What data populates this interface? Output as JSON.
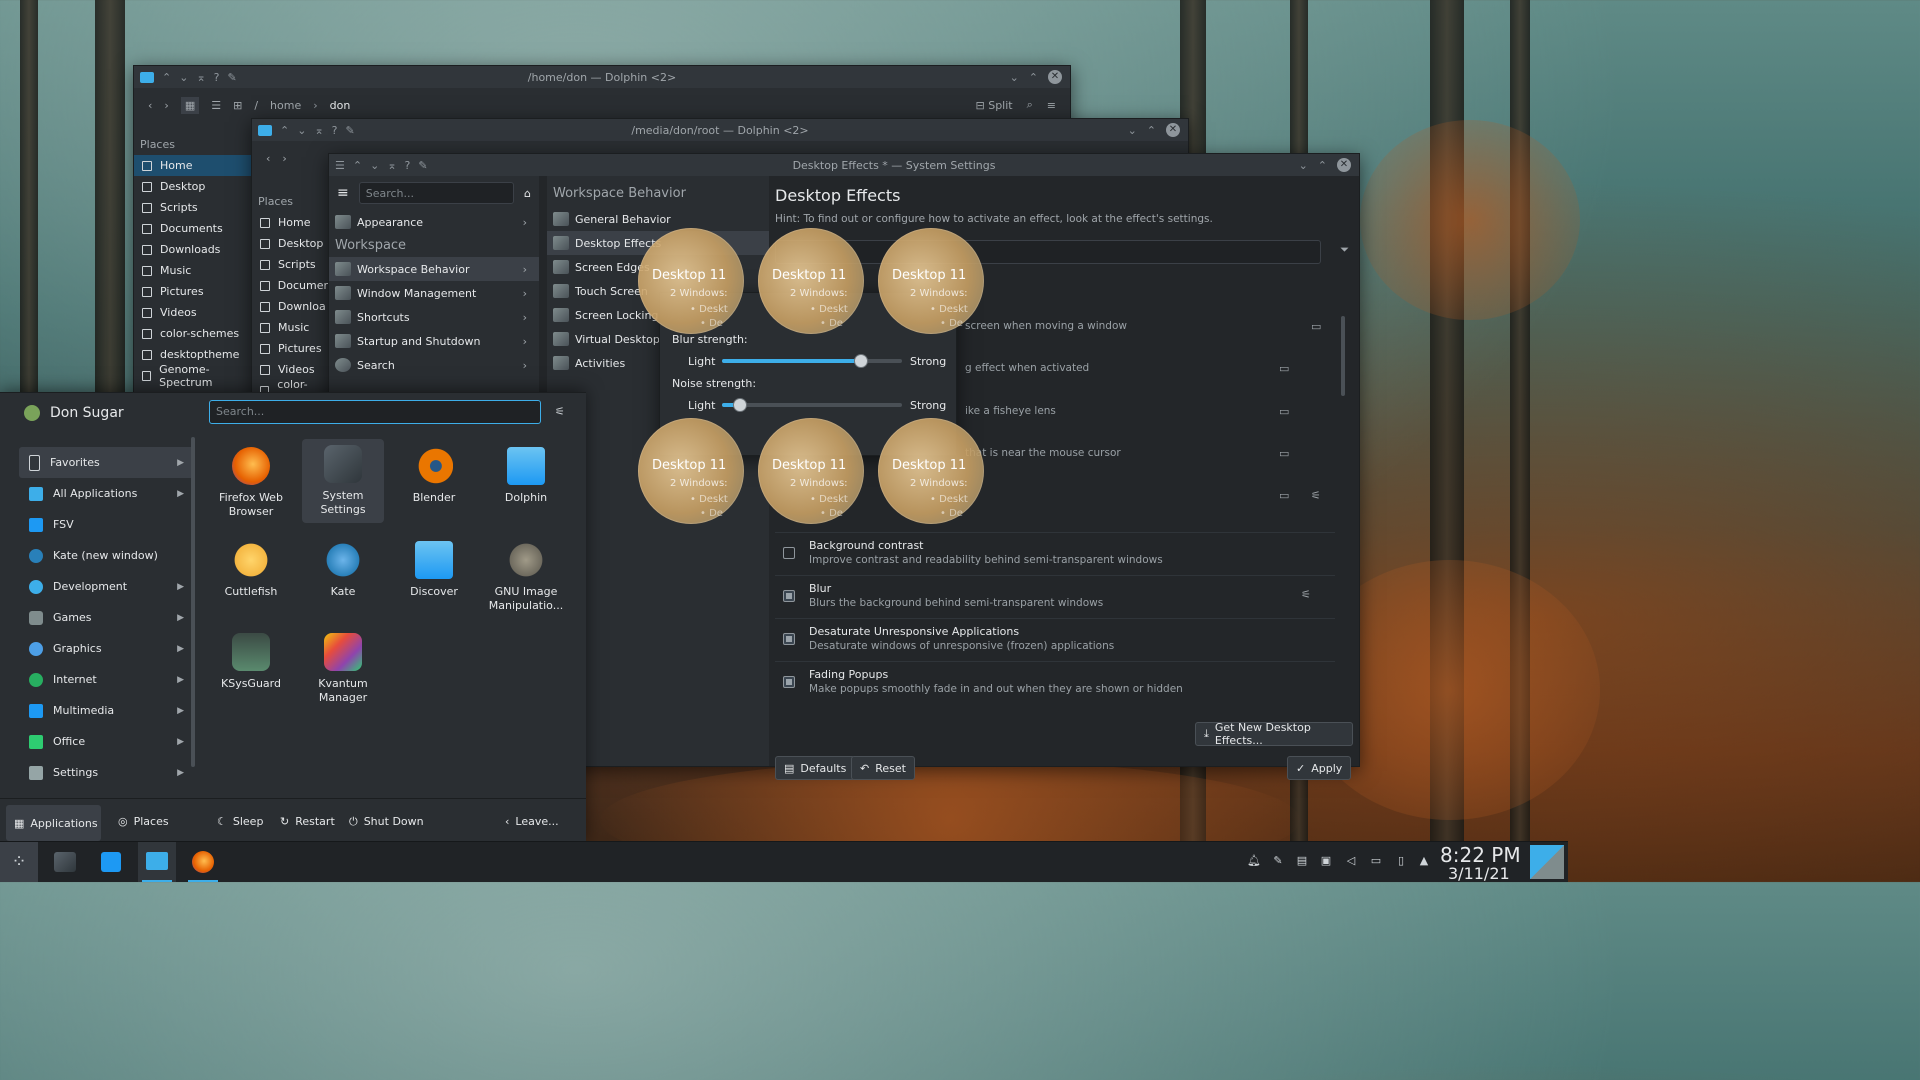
{
  "dolphin1": {
    "title": "/home/don — Dolphin <2>",
    "path": [
      "/",
      "home",
      "don"
    ],
    "split_label": "Split",
    "places_label": "Places",
    "places": [
      "Home",
      "Desktop",
      "Scripts",
      "Documents",
      "Downloads",
      "Music",
      "Pictures",
      "Videos",
      "color-schemes",
      "desktoptheme",
      "Genome-Spectrum"
    ]
  },
  "dolphin2": {
    "title": "/media/don/root — Dolphin <2>",
    "places_label": "Places",
    "places": [
      "Home",
      "Desktop",
      "Scripts",
      "Documer",
      "Downloa",
      "Music",
      "Pictures",
      "Videos",
      "color-sche"
    ]
  },
  "settings": {
    "title": "Desktop Effects * — System Settings",
    "search_placeholder": "Search...",
    "col1": {
      "appearance": "Appearance",
      "workspace_header": "Workspace",
      "items": [
        "Workspace Behavior",
        "Window Management",
        "Shortcuts",
        "Startup and Shutdown",
        "Search"
      ]
    },
    "col2_header": "Workspace Behavior",
    "col2_items": [
      "General Behavior",
      "Desktop Effects",
      "Screen Edges",
      "Touch Screen",
      "Screen Locking",
      "Virtual Desktops",
      "Activities"
    ],
    "page_title": "Desktop Effects",
    "hint": "Hint: To find out or configure how to activate an effect, look at the effect's settings.",
    "partial_rows": [
      {
        "text": "screen when moving a window"
      },
      {
        "text": "g effect when activated"
      },
      {
        "text": "ike a fisheye lens"
      },
      {
        "text": "that is near the mouse cursor"
      }
    ],
    "effects": [
      {
        "name": "Background contrast",
        "desc": "Improve contrast and readability behind semi-transparent windows",
        "checked": false
      },
      {
        "name": "Blur",
        "desc": "Blurs the background behind semi-transparent windows",
        "checked": true
      },
      {
        "name": "Desaturate Unresponsive Applications",
        "desc": "Desaturate windows of unresponsive (frozen) applications",
        "checked": true
      },
      {
        "name": "Fading Popups",
        "desc": "Make popups smoothly fade in and out when they are shown or hidden",
        "checked": true
      }
    ],
    "get_new": "Get New Desktop Effects...",
    "defaults": "Defaults",
    "reset": "Reset",
    "apply": "Apply"
  },
  "blur_dialog": {
    "blur_label": "Blur strength:",
    "noise_label": "Noise strength:",
    "light": "Light",
    "strong": "Strong",
    "blur_value": 0.77,
    "noise_value": 0.1
  },
  "bubbles": [
    {
      "title": "Desktop 11",
      "sub": "2 Windows:",
      "w1": "• Deskt",
      "w2": "• De"
    },
    {
      "title": "Desktop 11",
      "sub": "2 Windows:",
      "w1": "• Deskt",
      "w2": "• De"
    },
    {
      "title": "Desktop 11",
      "sub": "2 Windows:",
      "w1": "• Deskt",
      "w2": "• De"
    },
    {
      "title": "Desktop 11",
      "sub": "2 Windows:",
      "w1": "• Deskt",
      "w2": "• De"
    },
    {
      "title": "Desktop 11",
      "sub": "2 Windows:",
      "w1": "• Deskt",
      "w2": "• De"
    },
    {
      "title": "Desktop 11",
      "sub": "2 Windows:",
      "w1": "• Deskt",
      "w2": "• De"
    }
  ],
  "launcher": {
    "user": "Don Sugar",
    "search_placeholder": "Search...",
    "categories": [
      {
        "label": "Favorites",
        "arrow": true,
        "color": "#31363b"
      },
      {
        "label": "All Applications",
        "arrow": true,
        "color": "#3daee9"
      },
      {
        "label": "FSV",
        "arrow": false,
        "color": "#1d99f3"
      },
      {
        "label": "Kate (new window)",
        "arrow": false,
        "color": "#2980b9"
      },
      {
        "label": "Development",
        "arrow": true,
        "color": "#3daee9"
      },
      {
        "label": "Games",
        "arrow": true,
        "color": "#7f8c8d"
      },
      {
        "label": "Graphics",
        "arrow": true,
        "color": "#4d9fe6"
      },
      {
        "label": "Internet",
        "arrow": true,
        "color": "#27ae60"
      },
      {
        "label": "Multimedia",
        "arrow": true,
        "color": "#1d99f3"
      },
      {
        "label": "Office",
        "arrow": true,
        "color": "#2ecc71"
      },
      {
        "label": "Settings",
        "arrow": true,
        "color": "#95a5a6"
      }
    ],
    "apps": [
      {
        "label1": "Firefox Web",
        "label2": "Browser",
        "color": "#e66000"
      },
      {
        "label1": "System",
        "label2": "Settings",
        "color": "#4a5258"
      },
      {
        "label1": "Blender",
        "label2": "",
        "color": "#ea7600"
      },
      {
        "label1": "Dolphin",
        "label2": "",
        "color": "#3daee9"
      },
      {
        "label1": "Cuttlefish",
        "label2": "",
        "color": "#f4b642"
      },
      {
        "label1": "Kate",
        "label2": "",
        "color": "#2980b9"
      },
      {
        "label1": "Discover",
        "label2": "",
        "color": "#1d99f3"
      },
      {
        "label1": "GNU Image",
        "label2": "Manipulatio...",
        "color": "#6e6a5e"
      },
      {
        "label1": "KSysGuard",
        "label2": "",
        "color": "#5a8a6e"
      },
      {
        "label1": "Kvantum",
        "label2": "Manager",
        "color": "#c0392b"
      }
    ],
    "tabs": [
      "Applications",
      "Places"
    ],
    "actions": [
      "Sleep",
      "Restart",
      "Shut Down",
      "Leave..."
    ]
  },
  "clock": {
    "time": "8:22 PM",
    "date": "3/11/21"
  }
}
